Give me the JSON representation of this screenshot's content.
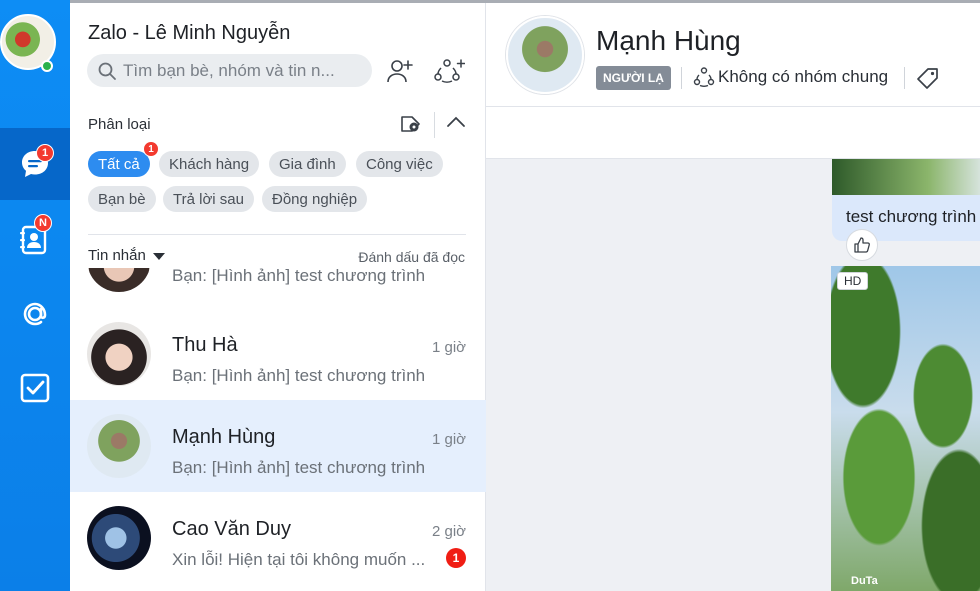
{
  "account": {
    "app_title": "Zalo - Lê Minh Nguyễn"
  },
  "rail": {
    "messages_badge": "1",
    "contacts_badge": "N"
  },
  "search": {
    "placeholder": "Tìm bạn bè, nhóm và tin n..."
  },
  "filter": {
    "title": "Phân loại",
    "chips": [
      {
        "label": "Tất cả",
        "active": true,
        "badge": "1"
      },
      {
        "label": "Khách hàng"
      },
      {
        "label": "Gia đình"
      },
      {
        "label": "Công việc"
      },
      {
        "label": "Bạn bè"
      },
      {
        "label": "Trả lời sau"
      },
      {
        "label": "Đồng nghiệp"
      }
    ]
  },
  "messages_header": {
    "title": "Tin nhắn",
    "mark_read": "Đánh dấu đã đọc"
  },
  "conversations": [
    {
      "name": "",
      "time": "",
      "preview": "Bạn: [Hình ảnh] test chương trình"
    },
    {
      "name": "Thu Hà",
      "time": "1 giờ",
      "preview": "Bạn: [Hình ảnh] test chương trình"
    },
    {
      "name": "Mạnh Hùng",
      "time": "1 giờ",
      "preview": "Bạn: [Hình ảnh] test chương trình",
      "selected": true
    },
    {
      "name": "Cao Văn Duy",
      "time": "2 giờ",
      "preview": "Xin lỗi! Hiện tại tôi không muốn ...",
      "unread": "1"
    }
  ],
  "chat": {
    "name": "Mạnh Hùng",
    "stranger_label": "NGƯỜI LẠ",
    "no_common_group": "Không có nhóm chung",
    "bubble_text": "test chương trình",
    "photo_quality": "HD",
    "photo_watermark": "DuTa"
  },
  "colors": {
    "brand": "#0b7fe8",
    "active_chip": "#2d8cf0",
    "selected_row": "#e5effd",
    "badge": "#f33a2f"
  }
}
